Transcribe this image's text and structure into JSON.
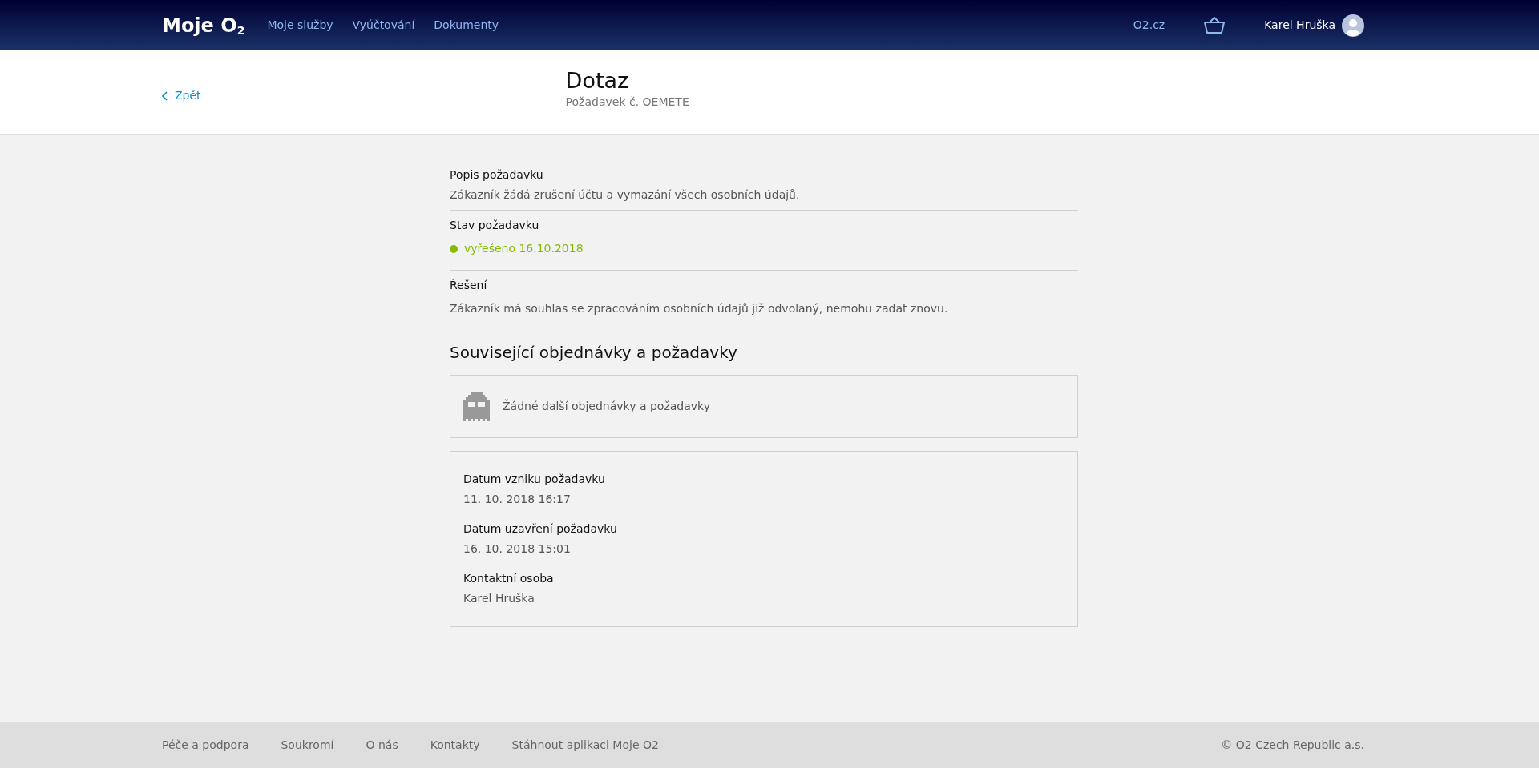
{
  "header": {
    "logo": "Moje O$_{2}$",
    "nav": [
      {
        "label": "Moje služby"
      },
      {
        "label": "Vyúčtování"
      },
      {
        "label": "Dokumenty"
      }
    ],
    "site_link": "O2.cz",
    "user_name": "Karel Hruška"
  },
  "subheader": {
    "back": "Zpět",
    "title": "Dotaz",
    "subtitle": "Požadavek č. OEMETE"
  },
  "details": [
    {
      "kind": "text",
      "label": "Popis požadavku",
      "value": "Zákazník žádá zrušení účtu a vymazání všech osobních údajů."
    },
    {
      "kind": "status",
      "label": "Stav požadavku",
      "value": "vyřešeno 16.10.2018",
      "color": "#84bd00"
    },
    {
      "kind": "text",
      "label": "Řešení",
      "value": "Zákazník má souhlas se zpracováním osobních údajů již odvolaný, nemohu zadat znovu."
    }
  ],
  "related": {
    "heading": "Související objednávky a požadavky",
    "empty_text": "Žádné další objednávky a požadavky"
  },
  "info": [
    {
      "label": "Datum vzniku požadavku",
      "value": "11. 10. 2018 16:17"
    },
    {
      "label": "Datum uzavření požadavku",
      "value": "16. 10. 2018 15:01"
    },
    {
      "label": "Kontaktní osoba",
      "value": "Karel Hruška"
    }
  ],
  "footer": {
    "links": [
      {
        "label": "Péče a podpora"
      },
      {
        "label": "Soukromí"
      },
      {
        "label": "O nás"
      },
      {
        "label": "Kontakty"
      },
      {
        "label": "Stáhnout aplikaci Moje O2"
      }
    ],
    "copyright": "© O2 Czech Republic a.s."
  }
}
